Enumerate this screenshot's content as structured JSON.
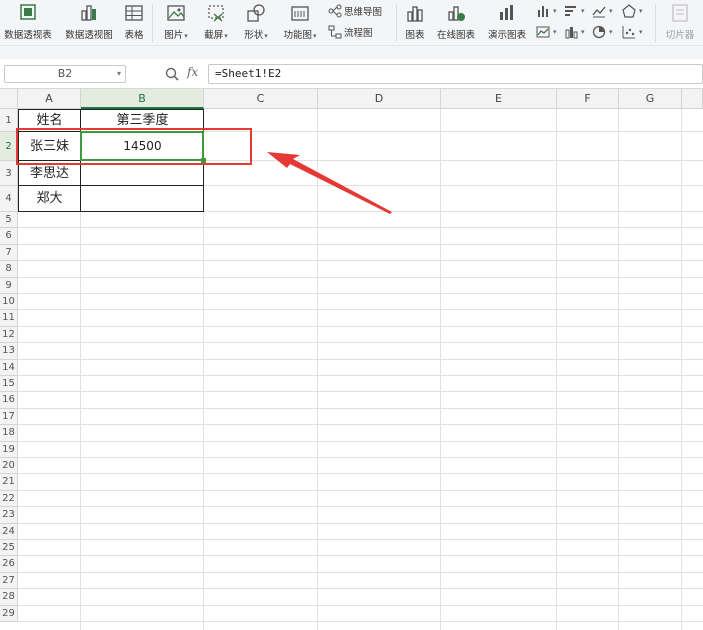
{
  "ribbon": {
    "pivot_table": "数据透视表",
    "pivot_chart": "数据透视图",
    "table": "表格",
    "picture": "图片",
    "screenshot": "截屏",
    "shapes": "形状",
    "function_chart": "功能图",
    "mind_map": "思维导图",
    "flowchart": "流程图",
    "chart": "图表",
    "online_chart": "在线图表",
    "demo_chart": "演示图表",
    "slicer": "切片器"
  },
  "formula_bar": {
    "name_box": "B2",
    "fx_label": "fx",
    "formula": "=Sheet1!E2"
  },
  "columns": [
    "A",
    "B",
    "C",
    "D",
    "E",
    "F",
    "G"
  ],
  "rows": [
    "1",
    "2",
    "3",
    "4",
    "5",
    "6",
    "7",
    "8",
    "9",
    "10",
    "11",
    "12",
    "13",
    "14",
    "15",
    "16",
    "17",
    "18",
    "19",
    "20",
    "21",
    "22",
    "23",
    "24",
    "25",
    "26",
    "27",
    "28",
    "29"
  ],
  "cells": {
    "A1": "姓名",
    "B1": "第三季度",
    "A2": "张三妹",
    "B2": "14500",
    "A3": "李思达",
    "A4": "郑大"
  },
  "selected_cell": "B2",
  "colors": {
    "selection": "#3f9a3f",
    "annotation": "#e53935"
  }
}
